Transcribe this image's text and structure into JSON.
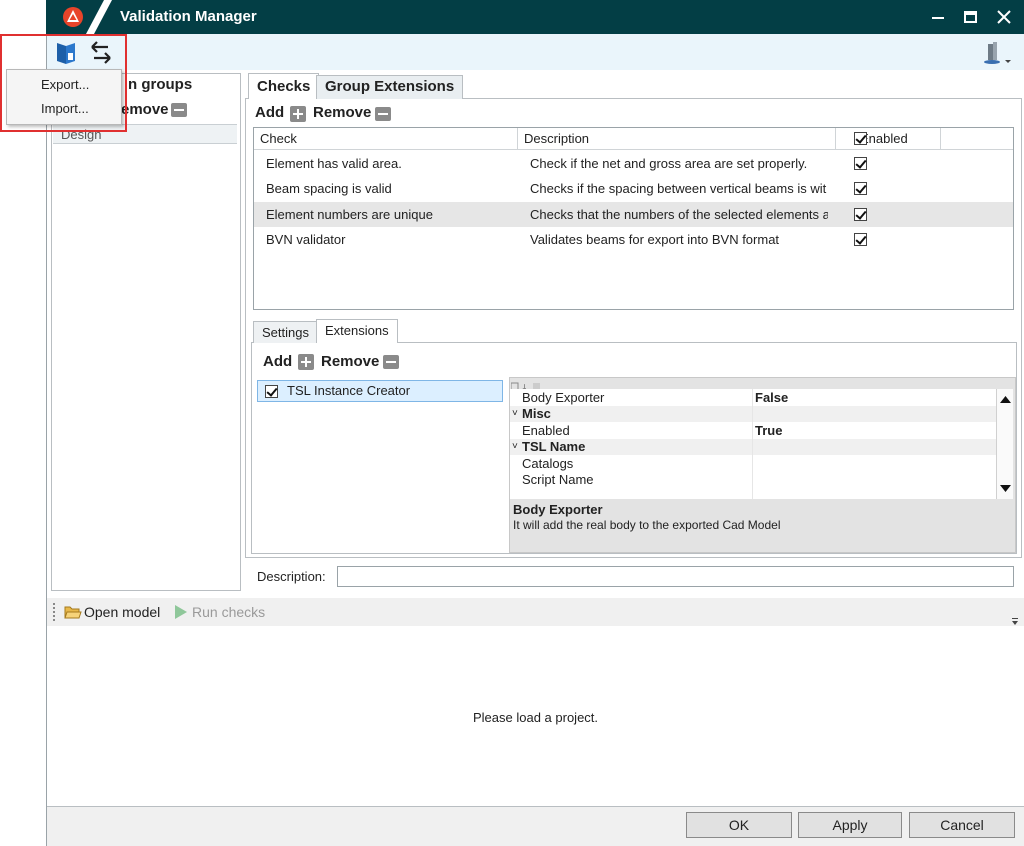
{
  "window": {
    "title": "Validation Manager"
  },
  "menu": {
    "export": "Export...",
    "import": "Import..."
  },
  "left_panel": {
    "title": "Validation groups",
    "title_visible": "n groups",
    "remove_label": "Remove",
    "remove_visible": "emove",
    "items": [
      "Design"
    ]
  },
  "tabs": {
    "checks": "Checks",
    "group_extensions": "Group Extensions"
  },
  "checks": {
    "add_label": "Add",
    "remove_label": "Remove",
    "columns": {
      "check": "Check",
      "description": "Description",
      "enabled": "Enabled"
    },
    "rows": [
      {
        "check": "Element has valid area.",
        "description": "Check if the net and gross area are set properly."
      },
      {
        "check": "Beam spacing is valid",
        "description": "Checks if the spacing between vertical beams is wit"
      },
      {
        "check": "Element numbers are unique",
        "description": "Checks that the numbers of the selected elements a"
      },
      {
        "check": "BVN validator",
        "description": "Validates beams for export into BVN format"
      }
    ]
  },
  "subtabs": {
    "settings": "Settings",
    "extensions": "Extensions"
  },
  "extensions": {
    "add_label": "Add",
    "remove_label": "Remove",
    "items": [
      "TSL Instance Creator"
    ]
  },
  "properties": {
    "body_exporter": {
      "name": "Body Exporter",
      "value": "False"
    },
    "cat_misc": "Misc",
    "enabled": {
      "name": "Enabled",
      "value": "True"
    },
    "cat_tsl": "TSL Name",
    "catalogs": "Catalogs",
    "script_name": "Script Name",
    "help_title": "Body Exporter",
    "help_text": "It will add the real body to the exported Cad Model"
  },
  "description_label": "Description:",
  "bottom_toolbar": {
    "open_model": "Open model",
    "run_checks": "Run checks"
  },
  "status_message": "Please load a project.",
  "footer": {
    "ok": "OK",
    "apply": "Apply",
    "cancel": "Cancel"
  }
}
